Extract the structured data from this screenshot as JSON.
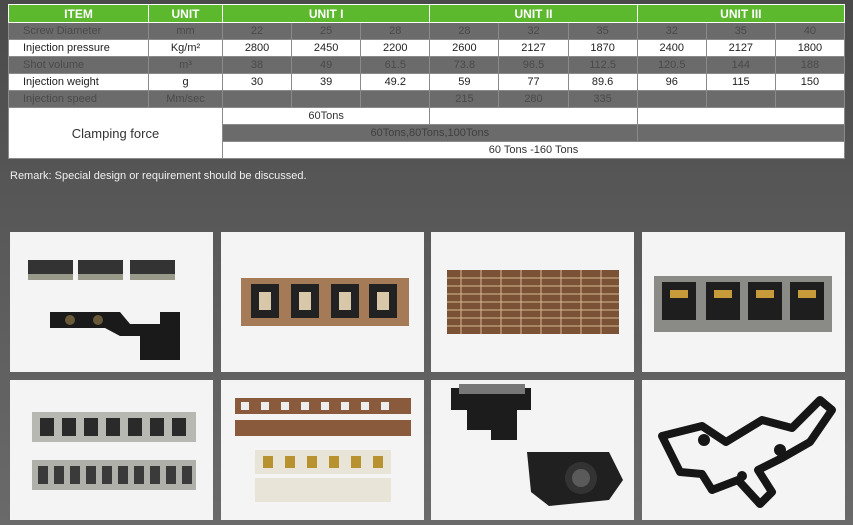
{
  "table": {
    "headers": [
      "ITEM",
      "UNIT",
      "UNIT I",
      "UNIT II",
      "UNIT III"
    ],
    "rows": [
      {
        "item": "Screw Diameter",
        "unit": "mm",
        "values": [
          "22",
          "25",
          "28",
          "28",
          "32",
          "35",
          "32",
          "35",
          "40"
        ]
      },
      {
        "item": "Injection pressure",
        "unit": "Kg/m²",
        "values": [
          "2800",
          "2450",
          "2200",
          "2600",
          "2127",
          "1870",
          "2400",
          "2127",
          "1800"
        ]
      },
      {
        "item": "Shot volume",
        "unit": "m³",
        "values": [
          "38",
          "49",
          "61.5",
          "73.8",
          "96.5",
          "112.5",
          "120.5",
          "144",
          "188"
        ]
      },
      {
        "item": "Injection weight",
        "unit": "g",
        "values": [
          "30",
          "39",
          "49.2",
          "59",
          "77",
          "89.6",
          "96",
          "115",
          "150"
        ]
      },
      {
        "item": "Injection speed",
        "unit": "Mm/sec",
        "values": [
          "",
          "",
          "",
          "215",
          "280",
          "335",
          "",
          "",
          ""
        ]
      }
    ],
    "clamping": {
      "label": "Clamping force",
      "unit1": "60Tons",
      "unit2": "60Tons,80Tons,100Tons",
      "unit3": "60 Tons -160 Tons"
    }
  },
  "remark": "Remark: Special design or requirement should be discussed.",
  "photos": [
    {
      "name": "product-photo-connector-strips-bracket"
    },
    {
      "name": "product-photo-terminal-frame-brown"
    },
    {
      "name": "product-photo-insert-sheet-grid"
    },
    {
      "name": "product-photo-sim-sockets-strip"
    },
    {
      "name": "product-photo-pin-header-strips"
    },
    {
      "name": "product-photo-double-terminal-strips"
    },
    {
      "name": "product-photo-black-connector-housings"
    },
    {
      "name": "product-photo-black-cable-harness-frame"
    }
  ]
}
